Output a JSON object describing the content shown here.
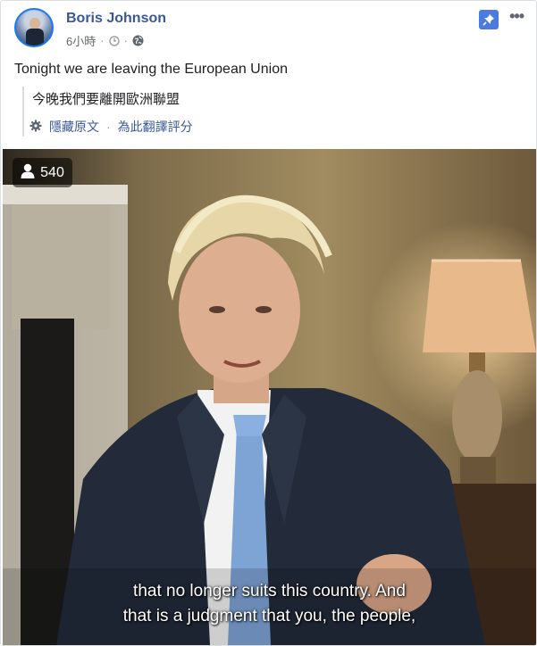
{
  "post": {
    "author": "Boris Johnson",
    "time": "6小時",
    "text": "Tonight we are leaving the European Union",
    "pinned_icon": "pin-icon",
    "more_icon": "more-options-icon"
  },
  "translation": {
    "text": "今晚我們要離開歐洲聯盟",
    "hide_original": "隱藏原文",
    "rate_translation": "為此翻譯評分"
  },
  "video": {
    "view_count": "540",
    "subtitle_line1": "that no longer suits this country. And",
    "subtitle_line2": "that is a judgment that you, the people,"
  },
  "colors": {
    "name": "#385898",
    "pin_bg": "#4b7be0"
  }
}
